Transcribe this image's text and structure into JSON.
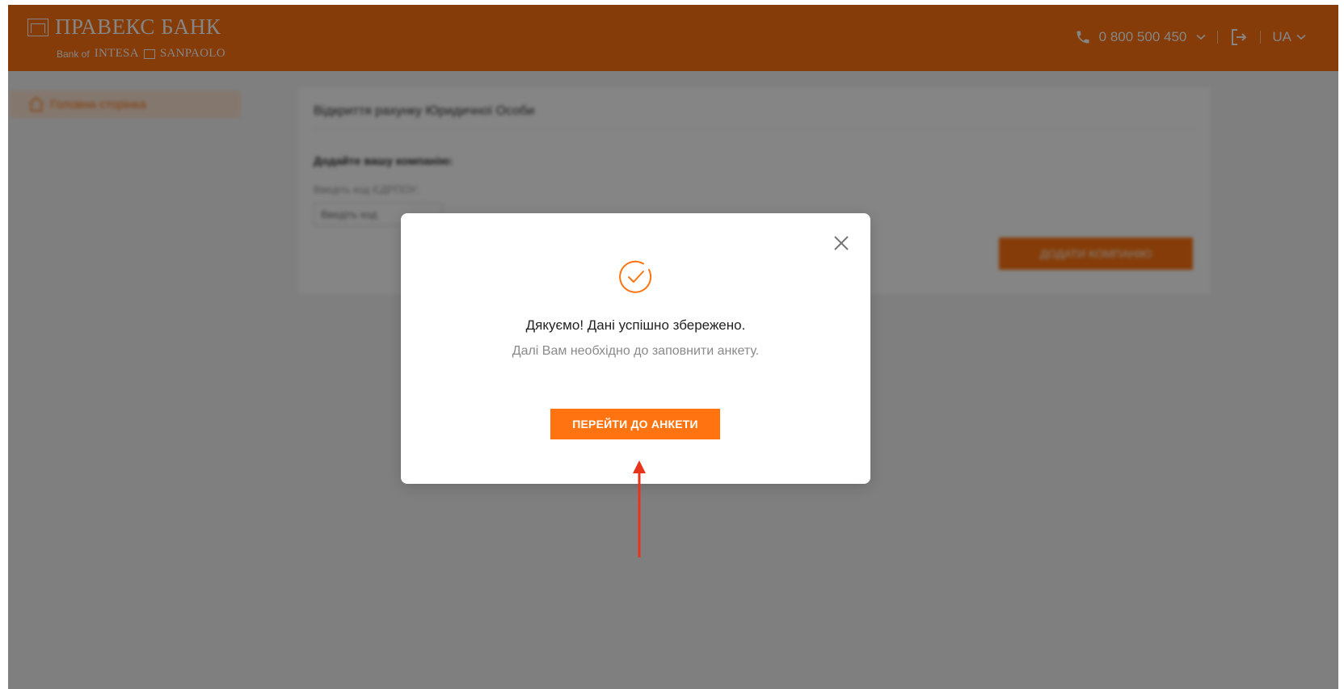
{
  "header": {
    "bank_name": "ПРАВЕКС БАНК",
    "bank_of": "Bank of",
    "intesa": "INTESA",
    "sanpaolo": "SANPAOLO",
    "phone": "0 800 500 450",
    "language": "UA"
  },
  "sidebar": {
    "items": [
      {
        "label": "Головна сторінка",
        "icon": "home-icon",
        "active": true
      }
    ]
  },
  "main": {
    "title": "Відкриття рахунку Юридичної Особи",
    "subtitle": "Додайте вашу компанію:",
    "field_label": "Введіть код ЄДРПОУ:",
    "field_placeholder": "Введіть код",
    "add_button": "ДОДАТИ КОМПАНІЮ"
  },
  "modal": {
    "title": "Дякуємо! Дані успішно збережено.",
    "text": "Далі Вам необхідно до заповнити анкету.",
    "button": "ПЕРЕЙТИ ДО АНКЕТИ",
    "icon": "check-circle-icon"
  },
  "colors": {
    "brand": "#ff7410",
    "annotation": "#e8341c"
  }
}
